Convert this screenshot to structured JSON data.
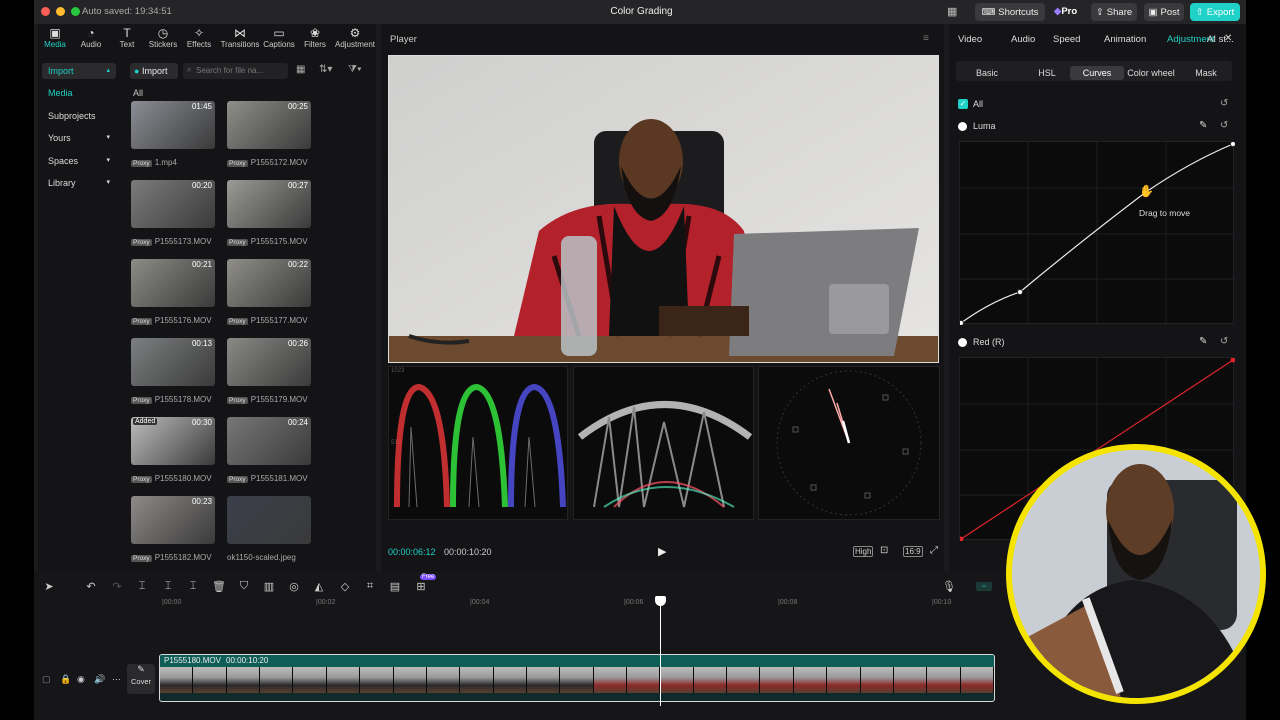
{
  "window": {
    "autosave": "Auto saved: 19:34:51",
    "title": "Color Grading"
  },
  "header": {
    "shortcuts": "Shortcuts",
    "pro": "Pro",
    "share": "Share",
    "post": "Post",
    "export": "Export"
  },
  "toolbar": [
    "Media",
    "Audio",
    "Text",
    "Stickers",
    "Effects",
    "Transitions",
    "Captions",
    "Filters",
    "Adjustment"
  ],
  "sidebar": {
    "import": "Import",
    "media": "Media",
    "subprojects": "Subprojects",
    "yours": "Yours",
    "spaces": "Spaces",
    "library": "Library"
  },
  "media": {
    "import_button": "Import",
    "search_placeholder": "Search for file na...",
    "filter_label": "All",
    "items": [
      {
        "name": "1.mp4",
        "duration": "01:45",
        "proxy": "Proxy",
        "added": ""
      },
      {
        "name": "P1555172.MOV",
        "duration": "00:25",
        "proxy": "Proxy",
        "added": ""
      },
      {
        "name": "P1555173.MOV",
        "duration": "00:20",
        "proxy": "Proxy",
        "added": ""
      },
      {
        "name": "P1555175.MOV",
        "duration": "00:27",
        "proxy": "Proxy",
        "added": ""
      },
      {
        "name": "P1555176.MOV",
        "duration": "00:21",
        "proxy": "Proxy",
        "added": ""
      },
      {
        "name": "P1555177.MOV",
        "duration": "00:22",
        "proxy": "Proxy",
        "added": ""
      },
      {
        "name": "P1555178.MOV",
        "duration": "00:13",
        "proxy": "Proxy",
        "added": ""
      },
      {
        "name": "P1555179.MOV",
        "duration": "00:26",
        "proxy": "Proxy",
        "added": ""
      },
      {
        "name": "P1555180.MOV",
        "duration": "00:30",
        "proxy": "Proxy",
        "added": "Added"
      },
      {
        "name": "P1555181.MOV",
        "duration": "00:24",
        "proxy": "Proxy",
        "added": ""
      },
      {
        "name": "P1555182.MOV",
        "duration": "00:23",
        "proxy": "Proxy",
        "added": ""
      },
      {
        "name": "ok1150-scaled.jpeg",
        "duration": "",
        "proxy": "",
        "added": ""
      }
    ]
  },
  "player": {
    "label": "Player",
    "current_time": "00:00:06:12",
    "total_time": "00:00:10:20",
    "quality": "High",
    "ratio": "16:9",
    "scope_max": "1023",
    "scope_mid": "512"
  },
  "inspector": {
    "tabs": [
      "Video",
      "Audio",
      "Speed",
      "Animation",
      "Adjustment",
      "AI st..."
    ],
    "active_tab": "Adjustment",
    "subtabs": [
      "Basic",
      "HSL",
      "Curves",
      "Color wheel",
      "Mask"
    ],
    "active_subtab": "Curves",
    "all_label": "All",
    "luma_label": "Luma",
    "red_label": "Red (R)",
    "tooltip": "Drag to move"
  },
  "timeline": {
    "ticks": [
      "00:00",
      "00:02",
      "00:04",
      "00:06",
      "00:08",
      "00:10"
    ],
    "clip_name": "P1555180.MOV",
    "clip_duration": "00:00:10:20",
    "cover": "Cover",
    "free_badge": "Free"
  },
  "colors": {
    "accent": "#1fd1c6",
    "webcam_ring": "#f5e400",
    "red_curve": "#e0242a"
  }
}
